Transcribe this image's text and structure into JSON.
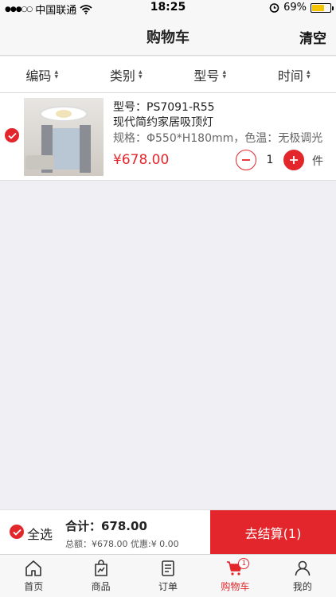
{
  "status_bar": {
    "carrier": "中国联通",
    "time": "18:25",
    "battery": "69%",
    "signal_icon": "signal-dots-icon",
    "wifi_icon": "wifi-icon",
    "alarm_icon": "alarm-icon",
    "battery_icon": "battery-icon"
  },
  "nav": {
    "title": "购物车",
    "clear_label": "清空"
  },
  "sort_bar": {
    "items": [
      {
        "label": "编码"
      },
      {
        "label": "类别"
      },
      {
        "label": "型号"
      },
      {
        "label": "时间"
      }
    ]
  },
  "cart": {
    "items": [
      {
        "selected": true,
        "model": "型号：PS7091-R55",
        "name": "现代简约家居吸顶灯",
        "spec": "规格：Φ550*H180mm，色温：无极调光",
        "price": "¥678.00",
        "quantity": "1",
        "unit": "件"
      }
    ]
  },
  "checkout": {
    "select_all_label": "全选",
    "total": "合计：678.00",
    "total_detail": "总额：¥678.00 优惠:¥ 0.00",
    "button_label": "去结算(1)"
  },
  "tab_bar": {
    "items": [
      {
        "label": "首页",
        "icon": "home-icon"
      },
      {
        "label": "商品",
        "icon": "goods-icon"
      },
      {
        "label": "订单",
        "icon": "order-icon"
      },
      {
        "label": "购物车",
        "icon": "cart-icon",
        "badge": "1",
        "active": true
      },
      {
        "label": "我的",
        "icon": "profile-icon"
      }
    ]
  },
  "colors": {
    "accent": "#e3262b",
    "background": "#efeff4"
  }
}
